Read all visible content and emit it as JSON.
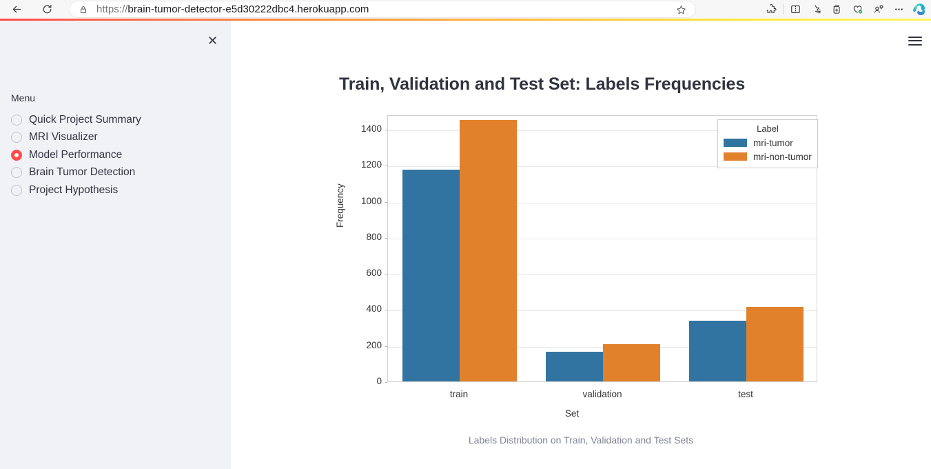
{
  "browser": {
    "url_scheme": "https://",
    "url_host": "brain-tumor-detector-e5d30222dbc4.herokuapp.com",
    "url_full": "https://brain-tumor-detector-e5d30222dbc4.herokuapp.com",
    "back_icon": "back-arrow-icon",
    "refresh_icon": "refresh-icon",
    "site_info_icon": "lock-icon",
    "favorite_icon": "star-icon",
    "toolbar_icons": [
      "extensions-icon",
      "split-screen-icon",
      "favorites-icon",
      "collections-icon",
      "browser-essentials-icon",
      "profile-icon",
      "settings-more-icon"
    ],
    "copilot_icon": "copilot-icon"
  },
  "sidebar": {
    "close_icon": "close-icon",
    "menu_label": "Menu",
    "items": [
      {
        "label": "Quick Project Summary",
        "selected": false
      },
      {
        "label": "MRI Visualizer",
        "selected": false
      },
      {
        "label": "Model Performance",
        "selected": true
      },
      {
        "label": "Brain Tumor Detection",
        "selected": false
      },
      {
        "label": "Project Hypothesis",
        "selected": false
      }
    ]
  },
  "main": {
    "hamburger_icon": "hamburger-menu-icon",
    "caption": "Labels Distribution on Train, Validation and Test Sets"
  },
  "theme": {
    "accent": "#ff4b4b",
    "sidebar_bg": "#f0f2f6",
    "text": "#31333f",
    "series_tumor": "#3274a1",
    "series_nontumor": "#e1812c"
  },
  "chart_data": {
    "type": "bar",
    "title": "Train, Validation and Test Set: Labels Frequencies",
    "xlabel": "Set",
    "ylabel": "Frequency",
    "categories": [
      "train",
      "validation",
      "test"
    ],
    "series": [
      {
        "name": "mri-tumor",
        "color": "#3274a1",
        "values": [
          1175,
          165,
          335
        ]
      },
      {
        "name": "mri-non-tumor",
        "color": "#e1812c",
        "values": [
          1450,
          206,
          412
        ]
      }
    ],
    "legend_title": "Label",
    "legend_position": "upper right",
    "ylim": [
      0,
      1480
    ],
    "yticks": [
      0,
      200,
      400,
      600,
      800,
      1000,
      1200,
      1400
    ],
    "ytick_labels": [
      "0",
      "200",
      "400",
      "600",
      "800",
      "1000",
      "1200",
      "1400"
    ],
    "grid": true,
    "caption": "Labels Distribution on Train, Validation and Test Sets"
  }
}
